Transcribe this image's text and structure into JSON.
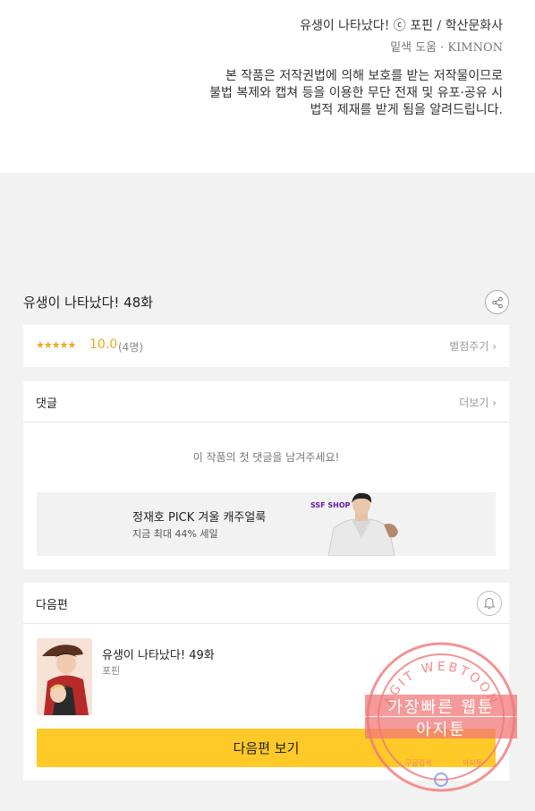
{
  "credits": {
    "title_line": "유생이 나타났다! ⓒ 포핀 / 학산문화사",
    "staff_line": "밑색 도움 · KIMNON",
    "notice_1": "본 작품은 저작권법에 의해 보호를 받는 저작물이므로",
    "notice_2": "불법 복제와 캡쳐 등을 이용한 무단 전재 및 유포·공유 시",
    "notice_3": "법적 제재를 받게 됨을 알려드립니다."
  },
  "episode": {
    "title": "유생이 나타났다! 48화"
  },
  "rating": {
    "stars": "★★★★★",
    "score": "10.0",
    "count": "(4명)",
    "rate_link": "별점주기 ›"
  },
  "comments": {
    "header": "댓글",
    "more": "더보기 ›",
    "empty": "이 작품의 첫 댓글을 남겨주세요!"
  },
  "ad": {
    "title": "정재호 PICK 겨울 캐주얼룩",
    "subtitle": "지금 최대 44% 세일",
    "brand": "SSF SHOP"
  },
  "next": {
    "header": "다음편",
    "title": "유생이 나타났다! 49화",
    "author": "포핀",
    "button": "다음편 보기"
  },
  "watermark": {
    "arc": "AGIT WEBTOON",
    "line1": "가장빠른 웹툰",
    "line2": "아지툰",
    "small_left": "구글검색",
    "small_right": "아지툰"
  },
  "colors": {
    "accent_star": "#f2a61d",
    "next_button": "#ffc927",
    "watermark": "#f07878"
  }
}
